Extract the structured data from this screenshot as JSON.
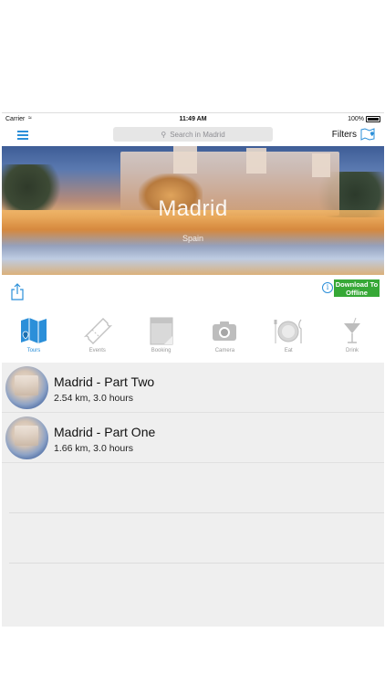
{
  "status_bar": {
    "carrier": "Carrier",
    "time": "11:49 AM",
    "battery": "100%"
  },
  "nav": {
    "search_placeholder": "Search in Madrid",
    "filters_label": "Filters"
  },
  "hero": {
    "title": "Madrid",
    "subtitle": "Spain"
  },
  "actions": {
    "info_glyph": "i",
    "download_label": "Download To Offline"
  },
  "categories": [
    {
      "label": "Tours",
      "icon": "map-icon",
      "active": true
    },
    {
      "label": "Events",
      "icon": "ticket-icon",
      "active": false
    },
    {
      "label": "Booking",
      "icon": "book-icon",
      "active": false
    },
    {
      "label": "Camera",
      "icon": "camera-icon",
      "active": false
    },
    {
      "label": "Eat",
      "icon": "plate-icon",
      "active": false
    },
    {
      "label": "Drink",
      "icon": "cocktail-icon",
      "active": false
    }
  ],
  "tours": [
    {
      "title": "Madrid - Part Two",
      "details": "2.54 km, 3.0 hours"
    },
    {
      "title": "Madrid - Part One",
      "details": "1.66 km, 3.0 hours"
    }
  ],
  "colors": {
    "accent": "#2b8fd9",
    "download": "#36a836",
    "list_bg": "#efefef"
  }
}
